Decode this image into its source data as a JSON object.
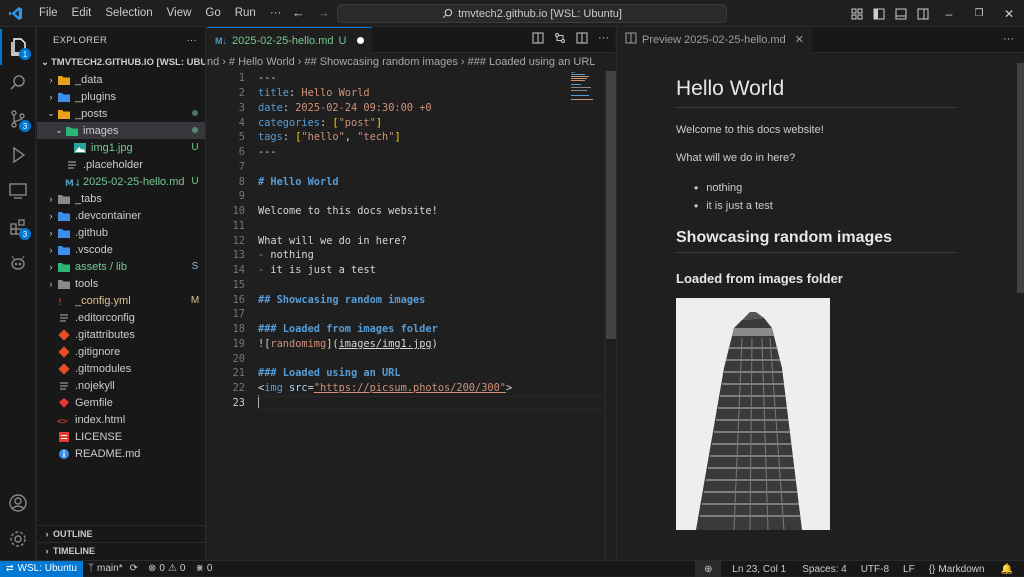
{
  "menu": [
    "File",
    "Edit",
    "Selection",
    "View",
    "Go",
    "Run",
    "···"
  ],
  "command_center": "tmvtech2.github.io [WSL: Ubuntu]",
  "activity_badges": {
    "explorer": "1",
    "scm": "3",
    "extensions": "3"
  },
  "explorer": {
    "title": "EXPLORER",
    "root": "TMVTECH2.GITHUB.IO [WSL: UBUN...",
    "items": [
      {
        "label": "_data",
        "status": ""
      },
      {
        "label": "_plugins",
        "status": ""
      },
      {
        "label": "_posts",
        "status": ""
      },
      {
        "label": "images",
        "status": ""
      },
      {
        "label": "img1.jpg",
        "status": "U"
      },
      {
        "label": ".placeholder",
        "status": ""
      },
      {
        "label": "2025-02-25-hello.md",
        "status": "U"
      },
      {
        "label": "_tabs",
        "status": ""
      },
      {
        "label": ".devcontainer",
        "status": ""
      },
      {
        "label": ".github",
        "status": ""
      },
      {
        "label": ".vscode",
        "status": ""
      },
      {
        "label": "assets / lib",
        "status": "S"
      },
      {
        "label": "tools",
        "status": ""
      },
      {
        "label": "_config.yml",
        "status": "M"
      },
      {
        "label": ".editorconfig",
        "status": ""
      },
      {
        "label": ".gitattributes",
        "status": ""
      },
      {
        "label": ".gitignore",
        "status": ""
      },
      {
        "label": ".gitmodules",
        "status": ""
      },
      {
        "label": ".nojekyll",
        "status": ""
      },
      {
        "label": "Gemfile",
        "status": ""
      },
      {
        "label": "index.html",
        "status": ""
      },
      {
        "label": "LICENSE",
        "status": ""
      },
      {
        "label": "README.md",
        "status": ""
      }
    ],
    "outline": "OUTLINE",
    "timeline": "TIMELINE"
  },
  "editor": {
    "tab_label": "2025-02-25-hello.md",
    "tab_status": "U",
    "breadcrumb": [
      "nd",
      "# Hello World",
      "## Showcasing random images",
      "### Loaded using an URL"
    ],
    "line_numbers": [
      "1",
      "2",
      "3",
      "4",
      "5",
      "6",
      "7",
      "8",
      "9",
      "10",
      "11",
      "12",
      "13",
      "14",
      "15",
      "16",
      "17",
      "18",
      "19",
      "20",
      "21",
      "22",
      "23"
    ],
    "lines": {
      "l1": "---",
      "l2k": "title",
      "l2v": "Hello World",
      "l3k": "date",
      "l3v": "2025-02-24 09:30:00 +0",
      "l4k": "categories",
      "l4v": "\"post\"",
      "l5k": "tags",
      "l5v1": "\"hello\"",
      "l5v2": "\"tech\"",
      "l6": "---",
      "l8": "# Hello World",
      "l10": "Welcome to this docs website!",
      "l12": "What will we do in here?",
      "l13": "nothing",
      "l14": "it is just a test",
      "l16": "## Showcasing random images",
      "l18": "### Loaded from images folder",
      "l19alt": "randomimg",
      "l19src": "images/img1.jpg",
      "l21": "### Loaded using an URL",
      "l22tag": "img",
      "l22attr": "src",
      "l22url": "\"https://picsum.photos/200/300\""
    }
  },
  "preview": {
    "tab_label": "Preview 2025-02-25-hello.md",
    "h1": "Hello World",
    "p1": "Welcome to this docs website!",
    "p2": "What will we do in here?",
    "list": [
      "nothing",
      "it is just a test"
    ],
    "h2": "Showcasing random images",
    "h3": "Loaded from images folder"
  },
  "status": {
    "remote": "WSL: Ubuntu",
    "branch": "main*",
    "errors": "0",
    "warnings": "0",
    "ports": "0",
    "position": "Ln 23, Col 1",
    "spaces": "Spaces: 4",
    "encoding": "UTF-8",
    "eol": "LF",
    "language": "Markdown"
  },
  "colors": {
    "accent": "#0078d4",
    "untracked": "#73c991",
    "modified": "#e2c08d",
    "keyword": "#569cd6",
    "string": "#ce9178"
  }
}
